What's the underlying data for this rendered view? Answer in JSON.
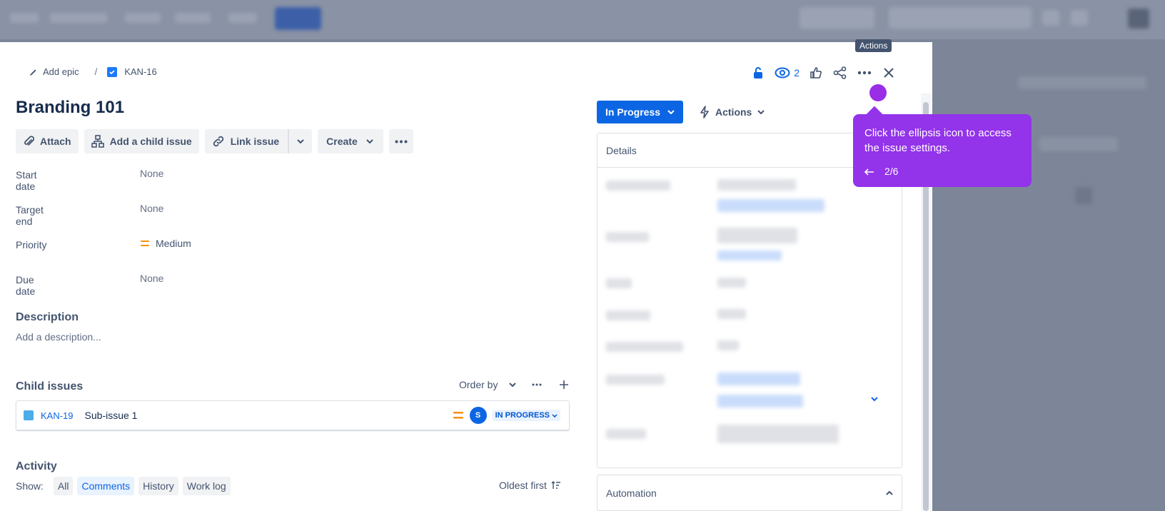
{
  "breadcrumb": {
    "epic_label": "Add epic",
    "separator": "/",
    "issue_key": "KAN-16"
  },
  "header": {
    "watch_count": "2"
  },
  "issue": {
    "title": "Branding 101"
  },
  "toolbar": {
    "attach": "Attach",
    "add_child": "Add a child issue",
    "link_issue": "Link issue",
    "create": "Create"
  },
  "fields": [
    {
      "label": "Start date",
      "value": "None"
    },
    {
      "label": "Target end",
      "value": "None"
    },
    {
      "label": "Priority",
      "value": "Medium"
    },
    {
      "label": "Due date",
      "value": "None"
    }
  ],
  "description": {
    "heading": "Description",
    "placeholder": "Add a description..."
  },
  "child_issues": {
    "heading": "Child issues",
    "order_by": "Order by",
    "items": [
      {
        "key": "KAN-19",
        "summary": "Sub-issue 1",
        "assignee_initial": "S",
        "status": "IN PROGRESS"
      }
    ]
  },
  "activity": {
    "heading": "Activity",
    "show_label": "Show:",
    "filters": [
      "All",
      "Comments",
      "History",
      "Work log"
    ],
    "active_filter": "Comments",
    "sort": "Oldest first"
  },
  "status_button": "In Progress",
  "actions_button": "Actions",
  "details": {
    "heading": "Details"
  },
  "automation": {
    "heading": "Automation"
  },
  "tooltip": {
    "text": "Actions"
  },
  "guide": {
    "text": "Click the ellipsis icon to access the issue settings.",
    "step": "2/6"
  },
  "colors": {
    "primary": "#0c66e4",
    "guide": "#9333ea",
    "priority": "#f79009"
  }
}
